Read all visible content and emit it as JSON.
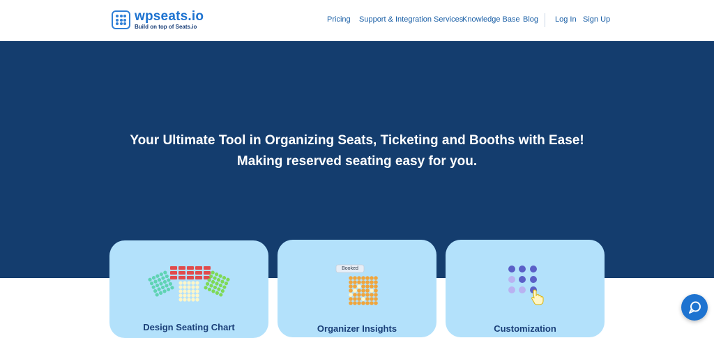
{
  "header": {
    "logo_title": "wpseats.io",
    "logo_sub": "Build on top of Seats.io"
  },
  "nav": {
    "pricing": "Pricing",
    "support": "Support & Integration Services",
    "knowledge": "Knowledge Base",
    "blog": "Blog",
    "login": "Log In",
    "signup": "Sign Up"
  },
  "hero": {
    "line1": "Your Ultimate Tool in Organizing Seats, Ticketing and Booths with Ease!",
    "line2": "Making reserved seating easy for you."
  },
  "cards": [
    {
      "title": "Design Seating Chart"
    },
    {
      "title": "Organizer Insights",
      "badge": "Booked"
    },
    {
      "title": "Customization"
    }
  ],
  "colors": {
    "brand": "#1e73d0",
    "hero_bg": "#143d6e",
    "card_bg": "#b3e1fb"
  },
  "icons": {
    "chat": "chat-bubble-icon"
  }
}
